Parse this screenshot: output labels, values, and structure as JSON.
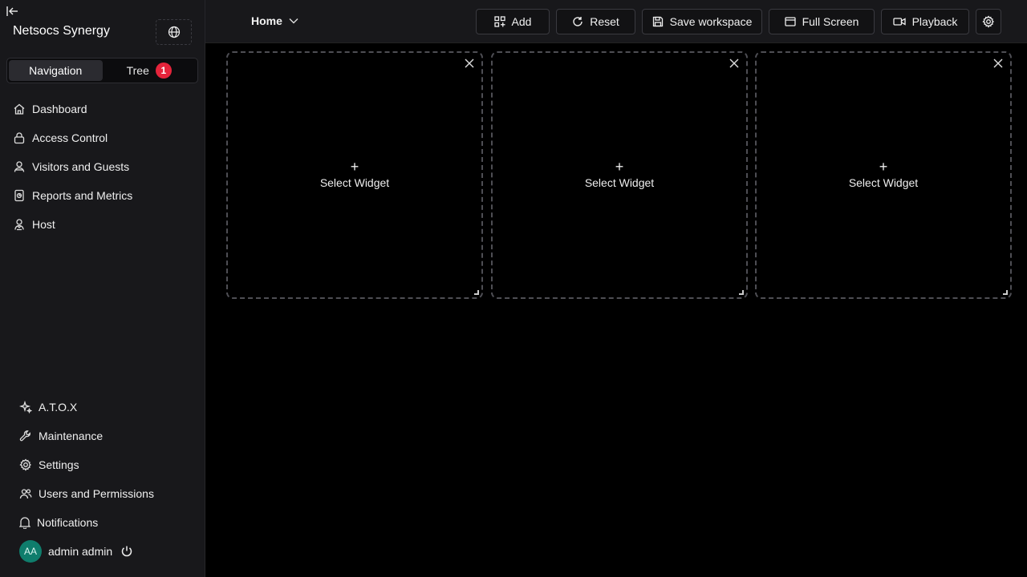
{
  "sidebar": {
    "title": "Netsocs Synergy",
    "tabs": [
      {
        "label": "Navigation"
      },
      {
        "label": "Tree",
        "badge": "1"
      }
    ],
    "nav_top": [
      {
        "label": "Dashboard",
        "icon": "home-icon"
      },
      {
        "label": "Access Control",
        "icon": "lock-icon"
      },
      {
        "label": "Visitors and Guests",
        "icon": "visitor-icon"
      },
      {
        "label": "Reports and Metrics",
        "icon": "report-icon"
      },
      {
        "label": "Host",
        "icon": "host-icon"
      }
    ],
    "nav_bottom": [
      {
        "label": "A.T.O.X",
        "icon": "sparkle-icon"
      },
      {
        "label": "Maintenance",
        "icon": "wrench-icon"
      },
      {
        "label": "Settings",
        "icon": "gear-icon"
      },
      {
        "label": "Users and Permissions",
        "icon": "users-icon"
      },
      {
        "label": "Notifications",
        "icon": "bell-icon"
      }
    ],
    "user": {
      "initials": "AA",
      "name": "admin admin"
    }
  },
  "topbar": {
    "workspace": "Home",
    "buttons": {
      "add": "Add",
      "reset": "Reset",
      "save": "Save workspace",
      "fullscreen": "Full Screen",
      "playback": "Playback"
    }
  },
  "widgets": [
    {
      "label": "Select Widget"
    },
    {
      "label": "Select Widget"
    },
    {
      "label": "Select Widget"
    }
  ],
  "colors": {
    "accent_badge": "#e5243b",
    "avatar": "#0f7d6c",
    "background": "#000000",
    "panel": "#18181b"
  }
}
